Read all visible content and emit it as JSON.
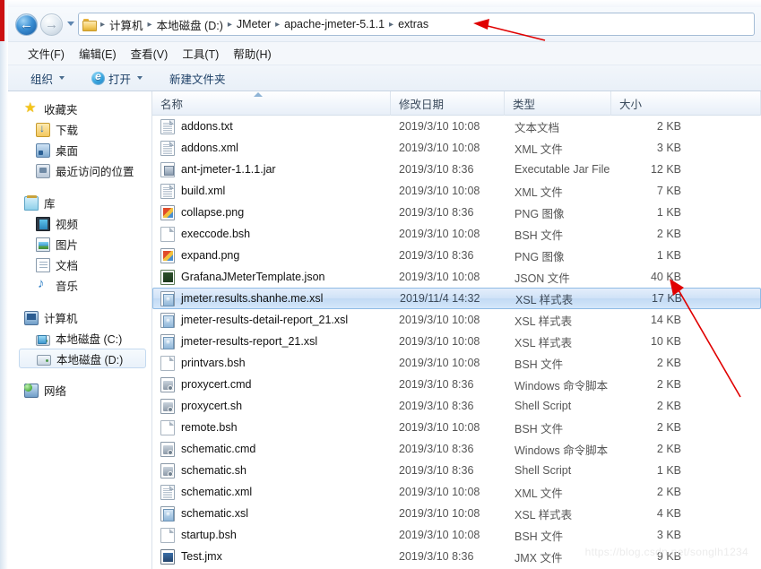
{
  "window": {
    "accent_color": "#3b8fd4",
    "annotation_color": "#e00000"
  },
  "navigation": {
    "back_glyph": "←",
    "forward_glyph": "→",
    "back_name": "back-button",
    "forward_name": "forward-button",
    "breadcrumbs": [
      "计算机",
      "本地磁盘 (D:)",
      "JMeter",
      "apache-jmeter-5.1.1",
      "extras"
    ],
    "separator": "▸"
  },
  "menubar": {
    "items": [
      "文件(F)",
      "编辑(E)",
      "查看(V)",
      "工具(T)",
      "帮助(H)"
    ]
  },
  "toolbar": {
    "organize_label": "组织",
    "open_label": "打开",
    "new_folder_label": "新建文件夹"
  },
  "navpane": {
    "groups": [
      {
        "header": {
          "label": "收藏夹",
          "icon": "star-icon"
        },
        "items": [
          {
            "label": "下载",
            "icon": "download-folder-icon"
          },
          {
            "label": "桌面",
            "icon": "desktop-icon"
          },
          {
            "label": "最近访问的位置",
            "icon": "recent-places-icon"
          }
        ]
      },
      {
        "header": {
          "label": "库",
          "icon": "library-icon"
        },
        "items": [
          {
            "label": "视频",
            "icon": "video-icon"
          },
          {
            "label": "图片",
            "icon": "picture-icon"
          },
          {
            "label": "文档",
            "icon": "documents-icon"
          },
          {
            "label": "音乐",
            "icon": "music-icon"
          }
        ]
      },
      {
        "header": {
          "label": "计算机",
          "icon": "computer-icon"
        },
        "items": [
          {
            "label": "本地磁盘 (C:)",
            "icon": "system-drive-icon",
            "selected": false
          },
          {
            "label": "本地磁盘 (D:)",
            "icon": "drive-icon",
            "selected": true
          }
        ]
      },
      {
        "header": {
          "label": "网络",
          "icon": "network-icon"
        },
        "items": []
      }
    ]
  },
  "filelist": {
    "columns": [
      {
        "label": "名称",
        "key": "name",
        "sorted": "asc"
      },
      {
        "label": "修改日期",
        "key": "date"
      },
      {
        "label": "类型",
        "key": "type"
      },
      {
        "label": "大小",
        "key": "size"
      }
    ],
    "rows": [
      {
        "name": "addons.txt",
        "date": "2019/3/10 10:08",
        "type": "文本文档",
        "size": "2 KB",
        "icon": "text-file-icon",
        "selected": false
      },
      {
        "name": "addons.xml",
        "date": "2019/3/10 10:08",
        "type": "XML 文件",
        "size": "3 KB",
        "icon": "xml-file-icon",
        "selected": false
      },
      {
        "name": "ant-jmeter-1.1.1.jar",
        "date": "2019/3/10 8:36",
        "type": "Executable Jar File",
        "size": "12 KB",
        "icon": "jar-file-icon",
        "selected": false
      },
      {
        "name": "build.xml",
        "date": "2019/3/10 10:08",
        "type": "XML 文件",
        "size": "7 KB",
        "icon": "xml-file-icon",
        "selected": false
      },
      {
        "name": "collapse.png",
        "date": "2019/3/10 8:36",
        "type": "PNG 图像",
        "size": "1 KB",
        "icon": "png-image-icon",
        "selected": false
      },
      {
        "name": "execcode.bsh",
        "date": "2019/3/10 10:08",
        "type": "BSH 文件",
        "size": "2 KB",
        "icon": "plain-file-icon",
        "selected": false
      },
      {
        "name": "expand.png",
        "date": "2019/3/10 8:36",
        "type": "PNG 图像",
        "size": "1 KB",
        "icon": "png-image-icon",
        "selected": false
      },
      {
        "name": "GrafanaJMeterTemplate.json",
        "date": "2019/3/10 10:08",
        "type": "JSON 文件",
        "size": "40 KB",
        "icon": "json-file-icon",
        "selected": false
      },
      {
        "name": "jmeter.results.shanhe.me.xsl",
        "date": "2019/11/4 14:32",
        "type": "XSL 样式表",
        "size": "17 KB",
        "icon": "xsl-file-icon",
        "selected": true
      },
      {
        "name": "jmeter-results-detail-report_21.xsl",
        "date": "2019/3/10 10:08",
        "type": "XSL 样式表",
        "size": "14 KB",
        "icon": "xsl-file-icon",
        "selected": false
      },
      {
        "name": "jmeter-results-report_21.xsl",
        "date": "2019/3/10 10:08",
        "type": "XSL 样式表",
        "size": "10 KB",
        "icon": "xsl-file-icon",
        "selected": false
      },
      {
        "name": "printvars.bsh",
        "date": "2019/3/10 10:08",
        "type": "BSH 文件",
        "size": "2 KB",
        "icon": "plain-file-icon",
        "selected": false
      },
      {
        "name": "proxycert.cmd",
        "date": "2019/3/10 8:36",
        "type": "Windows 命令脚本",
        "size": "2 KB",
        "icon": "script-file-icon",
        "selected": false
      },
      {
        "name": "proxycert.sh",
        "date": "2019/3/10 8:36",
        "type": "Shell Script",
        "size": "2 KB",
        "icon": "script-file-icon",
        "selected": false
      },
      {
        "name": "remote.bsh",
        "date": "2019/3/10 10:08",
        "type": "BSH 文件",
        "size": "2 KB",
        "icon": "plain-file-icon",
        "selected": false
      },
      {
        "name": "schematic.cmd",
        "date": "2019/3/10 8:36",
        "type": "Windows 命令脚本",
        "size": "2 KB",
        "icon": "script-file-icon",
        "selected": false
      },
      {
        "name": "schematic.sh",
        "date": "2019/3/10 8:36",
        "type": "Shell Script",
        "size": "1 KB",
        "icon": "script-file-icon",
        "selected": false
      },
      {
        "name": "schematic.xml",
        "date": "2019/3/10 10:08",
        "type": "XML 文件",
        "size": "2 KB",
        "icon": "xml-file-icon",
        "selected": false
      },
      {
        "name": "schematic.xsl",
        "date": "2019/3/10 10:08",
        "type": "XSL 样式表",
        "size": "4 KB",
        "icon": "xsl-file-icon",
        "selected": false
      },
      {
        "name": "startup.bsh",
        "date": "2019/3/10 10:08",
        "type": "BSH 文件",
        "size": "3 KB",
        "icon": "plain-file-icon",
        "selected": false
      },
      {
        "name": "Test.jmx",
        "date": "2019/3/10 8:36",
        "type": "JMX 文件",
        "size": "9 KB",
        "icon": "jmx-file-icon",
        "selected": false
      }
    ]
  },
  "watermark": {
    "text": "https://blog.csdn.net/songlh1234"
  }
}
